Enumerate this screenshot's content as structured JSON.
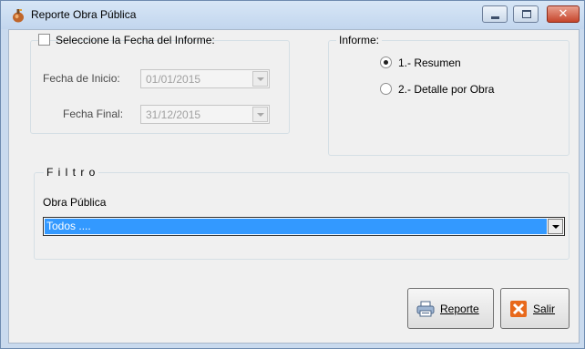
{
  "window": {
    "title": "Reporte Obra Pública",
    "caption_buttons": {
      "minimize": "minimize",
      "maximize": "maximize",
      "close": "✕"
    }
  },
  "date_group": {
    "checkbox_label": "Seleccione la Fecha del Informe:",
    "checked": false,
    "start_label": "Fecha de Inicio:",
    "start_value": "01/01/2015",
    "end_label": "Fecha Final:",
    "end_value": "31/12/2015"
  },
  "report_group": {
    "legend": "Informe:",
    "options": [
      {
        "label": "1.- Resumen",
        "checked": true
      },
      {
        "label": "2.- Detalle por Obra",
        "checked": false
      }
    ]
  },
  "filter_group": {
    "legend": "F i l t r o",
    "obra_label": "Obra Pública",
    "obra_value": "Todos ...."
  },
  "buttons": {
    "report": "Reporte",
    "exit": "Salir"
  },
  "colors": {
    "selection": "#3399ff",
    "close_button": "#c6452b",
    "exit_icon": "#e8691c"
  },
  "icons": {
    "app": "app-icon",
    "report": "printer-icon",
    "exit": "exit-x-icon"
  }
}
